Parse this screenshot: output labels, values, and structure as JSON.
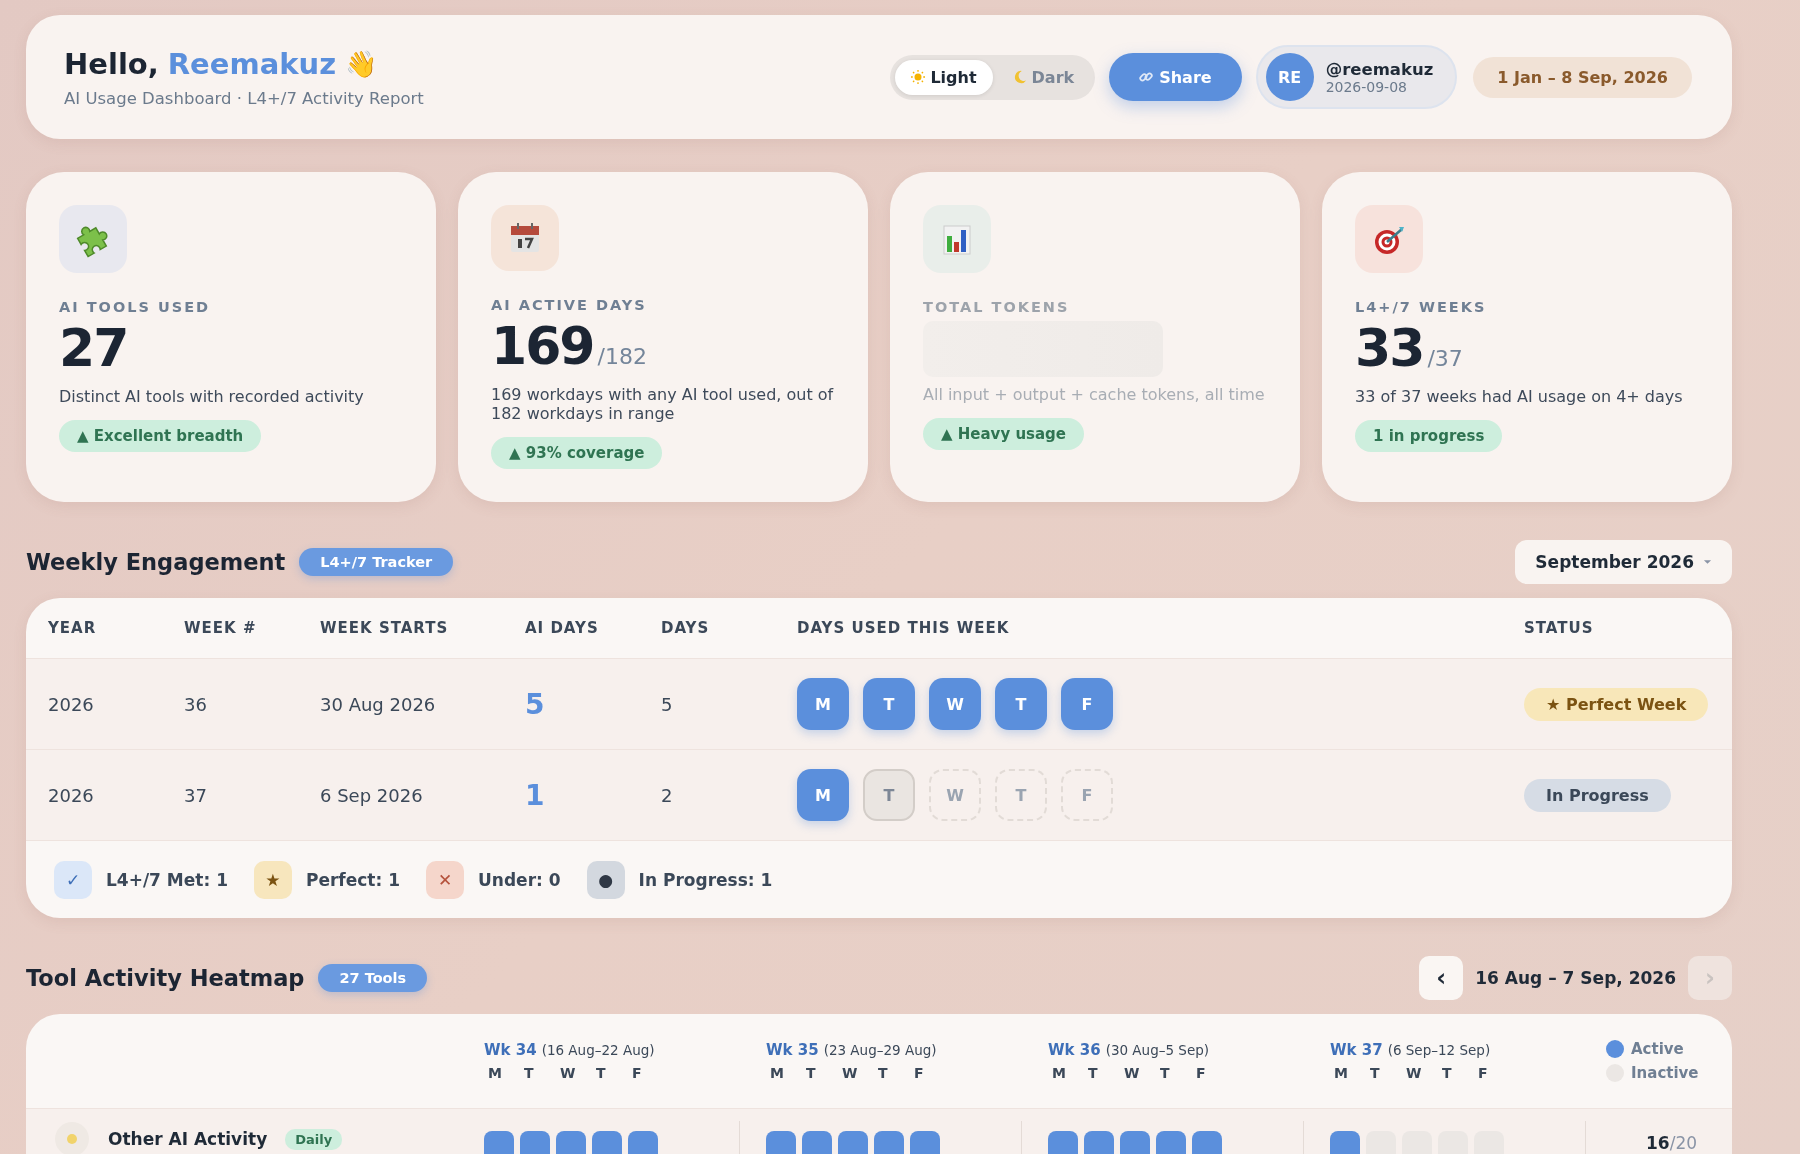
{
  "header": {
    "greeting": "Hello,",
    "name": "Reemakuz",
    "emoji": "👋",
    "subtitle": "AI Usage Dashboard · L4+/7 Activity Report",
    "theme_options": [
      {
        "label": "Light",
        "kind": "sun",
        "selected": true
      },
      {
        "label": "Dark",
        "kind": "moon",
        "selected": false
      }
    ],
    "share": "Share",
    "user": {
      "initials": "RE",
      "handle": "@reemakuz",
      "date": "2026-09-08"
    },
    "date_range": "1 Jan – 8 Sep, 2026"
  },
  "stats": [
    {
      "kind": "puzzle",
      "label": "AI TOOLS USED",
      "value": "27",
      "description": "Distinct AI tools with recorded activity",
      "badge": "▲ Excellent breadth",
      "loading": false
    },
    {
      "kind": "calendar",
      "label": "AI ACTIVE DAYS",
      "value": "169",
      "total": "/182",
      "description": "169 workdays with any AI tool used, out of 182 workdays in range",
      "badge": "▲ 93% coverage",
      "loading": false
    },
    {
      "kind": "chart",
      "label": "TOTAL TOKENS",
      "description": "All input + output + cache tokens, all time",
      "badge": "▲ Heavy usage",
      "loading": true
    },
    {
      "kind": "target",
      "label": "L4+/7 WEEKS",
      "value": "33",
      "total": "/37",
      "description": "33 of 37 weeks had AI usage on 4+ days",
      "badge": "1 in progress",
      "loading": false
    }
  ],
  "weekly": {
    "title": "Weekly Engagement",
    "badge": "L4+/7 Tracker",
    "month_select": "September 2026",
    "columns": [
      "YEAR",
      "WEEK #",
      "WEEK STARTS",
      "AI DAYS",
      "DAYS",
      "DAYS USED THIS WEEK",
      "STATUS"
    ],
    "rows": [
      {
        "year": "2026",
        "week": "36",
        "starts": "30 Aug 2026",
        "ai_days": "5",
        "days": "5",
        "days_used": [
          {
            "letter": "M",
            "kind": "used"
          },
          {
            "letter": "T",
            "kind": "used"
          },
          {
            "letter": "W",
            "kind": "used"
          },
          {
            "letter": "T",
            "kind": "used"
          },
          {
            "letter": "F",
            "kind": "used"
          }
        ],
        "status": {
          "label": "★ Perfect Week",
          "kind": "perfect"
        }
      },
      {
        "year": "2026",
        "week": "37",
        "starts": "6 Sep 2026",
        "ai_days": "1",
        "days": "2",
        "days_used": [
          {
            "letter": "M",
            "kind": "used"
          },
          {
            "letter": "T",
            "kind": "unused"
          },
          {
            "letter": "W",
            "kind": "future"
          },
          {
            "letter": "T",
            "kind": "future"
          },
          {
            "letter": "F",
            "kind": "future"
          }
        ],
        "status": {
          "label": "In Progress",
          "kind": "progress"
        }
      }
    ],
    "legend": [
      {
        "kind": "met",
        "icon": "✓",
        "label": "L4+/7 Met: 1"
      },
      {
        "kind": "perfect",
        "icon": "★",
        "label": "Perfect: 1"
      },
      {
        "kind": "under",
        "icon": "✕",
        "label": "Under: 0"
      },
      {
        "kind": "progress",
        "icon": "●",
        "label": "In Progress: 1"
      }
    ]
  },
  "heatmap": {
    "title": "Tool Activity Heatmap",
    "badge": "27 Tools",
    "prev": "‹",
    "range": "16 Aug – 7 Sep, 2026",
    "next": "›",
    "next_disabled": true,
    "weeks": [
      {
        "label": "Wk 34",
        "range": "(16 Aug–22 Aug)",
        "days": [
          "M",
          "T",
          "W",
          "T",
          "F"
        ]
      },
      {
        "label": "Wk 35",
        "range": "(23 Aug–29 Aug)",
        "days": [
          "M",
          "T",
          "W",
          "T",
          "F"
        ]
      },
      {
        "label": "Wk 36",
        "range": "(30 Aug–5 Sep)",
        "days": [
          "M",
          "T",
          "W",
          "T",
          "F"
        ]
      },
      {
        "label": "Wk 37",
        "range": "(6 Sep–12 Sep)",
        "days": [
          "M",
          "T",
          "W",
          "T",
          "F"
        ]
      }
    ],
    "legend": [
      {
        "kind": "active",
        "label": "Active"
      },
      {
        "kind": "inactive",
        "label": "Inactive"
      }
    ],
    "rows": [
      {
        "name": "Other AI Activity",
        "badge": "Daily",
        "weeks": [
          [
            true,
            true,
            true,
            true,
            true
          ],
          [
            true,
            true,
            true,
            true,
            true
          ],
          [
            true,
            true,
            true,
            true,
            true
          ],
          [
            true,
            false,
            false,
            false,
            false
          ]
        ],
        "count": "16",
        "total": "/20"
      }
    ]
  }
}
